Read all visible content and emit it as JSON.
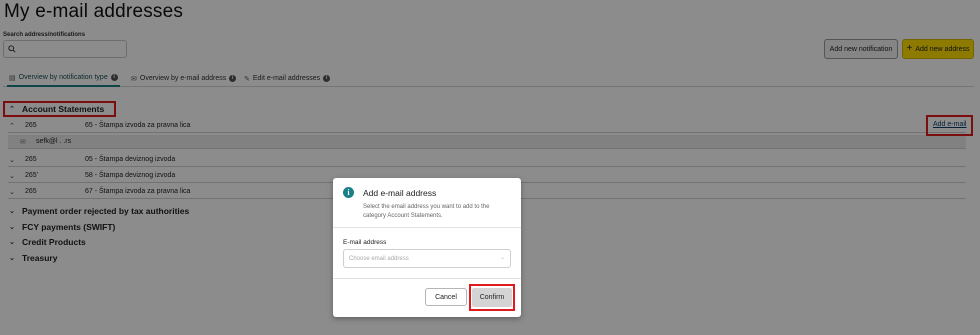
{
  "page": {
    "title": "My e-mail addresses"
  },
  "search": {
    "label": "Search address/notifications",
    "placeholder": ""
  },
  "actions": {
    "add_notification": "Add new notification",
    "add_address": "Add new address"
  },
  "tabs": [
    {
      "label": "Overview by notification type",
      "active": true
    },
    {
      "label": "Overview by e-mail address",
      "active": false
    },
    {
      "label": "Edit e-mail addresses",
      "active": false
    }
  ],
  "categories": [
    {
      "label": "Account Statements",
      "expanded": true
    },
    {
      "label": "Payment order rejected by tax authorities",
      "expanded": false
    },
    {
      "label": "FCY payments (SWIFT)",
      "expanded": false
    },
    {
      "label": "Credit Products",
      "expanded": false
    },
    {
      "label": "Treasury",
      "expanded": false
    }
  ],
  "rows": [
    {
      "account": "265",
      "description": "65 - Štampa izvoda za pravna lica",
      "expanded": true
    },
    {
      "account": "265",
      "description": "05 - Štampa deviznog izvoda",
      "expanded": false
    },
    {
      "account": "265'",
      "description": "58 - Štampa deviznog izvoda",
      "expanded": false
    },
    {
      "account": "265",
      "description": "67 - Štampa izvoda za pravna lica",
      "expanded": false
    }
  ],
  "sub_row": {
    "email": "sefk@l    .      .rs"
  },
  "add_email_link": "Add e-mail",
  "modal": {
    "title": "Add e-mail address",
    "description": "Select the email address you want to add to the category Account Statements.",
    "field_label": "E-mail address",
    "select_placeholder": "Choose email address",
    "cancel": "Cancel",
    "confirm": "Confirm"
  },
  "colors": {
    "accent": "#1a7f86",
    "primary_button": "#ffe100",
    "highlight": "#e01b1b"
  }
}
